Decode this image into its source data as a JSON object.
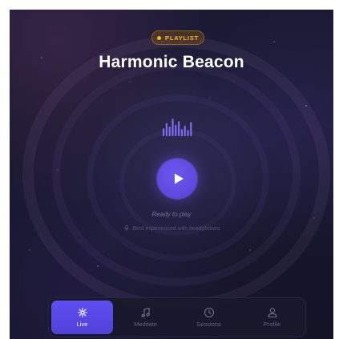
{
  "badge": {
    "label": "PLAYLIST"
  },
  "player": {
    "title": "Harmonic Beacon",
    "play_icon": "play-icon",
    "status": "Ready to play",
    "hint": "Best experienced with headphones",
    "hint_icon": "microphone-icon",
    "equalizer_levels": [
      0.45,
      0.75,
      0.55,
      1.0,
      0.65,
      0.85,
      0.4,
      0.6,
      0.35,
      0.8
    ]
  },
  "tabs": [
    {
      "label": "Live",
      "icon": "sparkle-icon",
      "active": true
    },
    {
      "label": "Meditate",
      "icon": "music-note-icon",
      "active": false
    },
    {
      "label": "Sessions",
      "icon": "clock-icon",
      "active": false
    },
    {
      "label": "Profile",
      "icon": "user-icon",
      "active": false
    }
  ],
  "colors": {
    "accent": "#5b48e6",
    "badge_text": "#f2b234",
    "background": "#16172c",
    "equalizer": "#7d6cf2"
  }
}
